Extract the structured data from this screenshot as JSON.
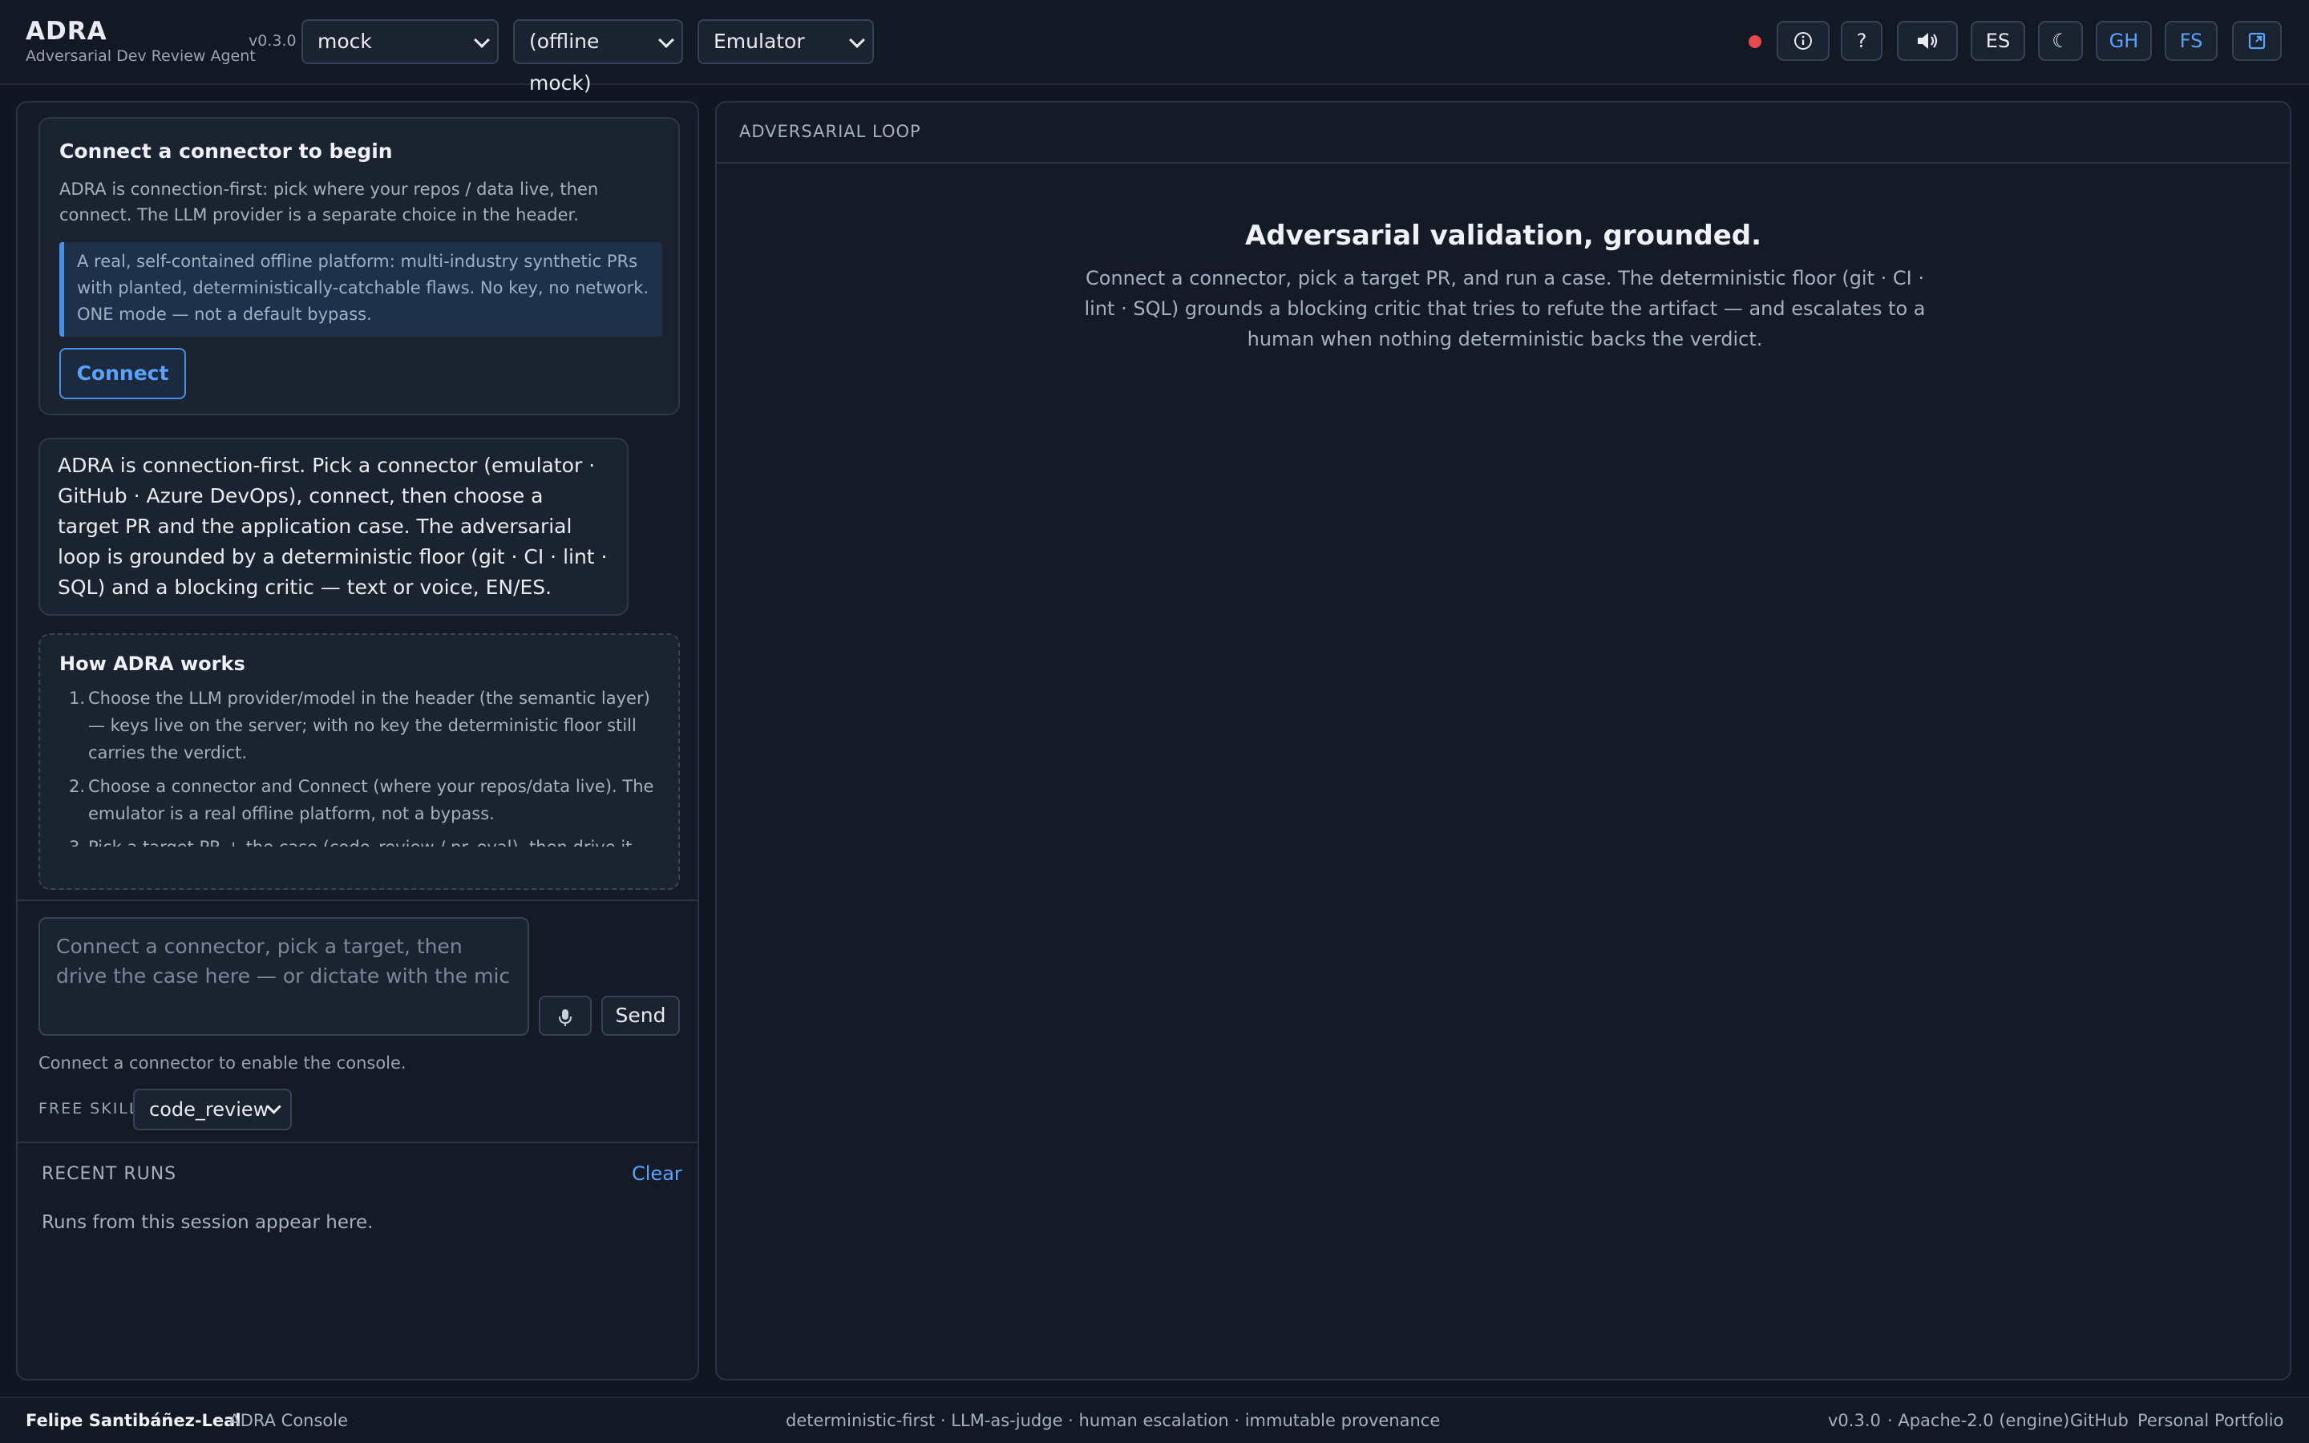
{
  "header": {
    "app_name": "ADRA",
    "app_subtitle": "Adversarial Dev Review Agent",
    "version": "v0.3.0",
    "provider_select": "mock",
    "model_select": "(offline mock)",
    "connector_select": "Emulator",
    "buttons": {
      "info": "info-icon",
      "help": "?",
      "speaker": "speaker-icon",
      "language": "ES",
      "theme": "☾",
      "github": "GH",
      "fullscreen": "FS",
      "external": "external-link-icon"
    },
    "record_indicator_color": "#e5484d"
  },
  "connector_card": {
    "title": "Connect a connector to begin",
    "text": "ADRA is connection-first: pick where your repos / data live, then connect. The LLM provider is a separate choice in the header.",
    "note": "A real, self-contained offline platform: multi-industry synthetic PRs with planted, deterministically-catchable flaws. No key, no network. ONE mode — not a default bypass.",
    "connect_label": "Connect"
  },
  "assistant_message": "ADRA is connection-first. Pick a connector (emulator · GitHub · Azure DevOps), connect, then choose a target PR and the application case. The adversarial loop is grounded by a deterministic floor (git · CI · lint · SQL) and a blocking critic — text or voice, EN/ES.",
  "how_it_works": {
    "title": "How ADRA works",
    "steps": [
      "Choose the LLM provider/model in the header (the semantic layer) — keys live on the server; with no key the deterministic floor still carries the verdict.",
      "Choose a connector and Connect (where your repos/data live). The emulator is a real offline platform, not a bypass.",
      "Pick a target PR + the case (code_review / pr_eval), then drive it"
    ]
  },
  "console": {
    "input_placeholder": "Connect a connector, pick a target, then drive the case here — or dictate with the mic",
    "mic_icon": "microphone-icon",
    "send_label": "Send",
    "hint": "Connect a connector to enable the console.",
    "skill_label": "FREE SKILL",
    "skill_value": "code_review"
  },
  "recent_runs": {
    "title": "RECENT RUNS",
    "clear_label": "Clear",
    "empty_text": "Runs from this session appear here."
  },
  "main": {
    "panel_label": "ADVERSARIAL LOOP",
    "hero_title": "Adversarial validation, grounded.",
    "hero_text": "Connect a connector, pick a target PR, and run a case. The deterministic floor (git · CI · lint · SQL) grounds a blocking critic that tries to refute the artifact — and escalates to a human when nothing deterministic backs the verdict."
  },
  "footer": {
    "author": "Felipe Santibáñez-Leal",
    "console_label": "· ADRA Console",
    "tagline": "deterministic-first · LLM-as-judge · human escalation · immutable provenance",
    "version": "v0.3.0",
    "license": "· Apache-2.0 (engine)",
    "links": [
      "GitHub",
      "Personal",
      "Portfolio"
    ]
  },
  "colors": {
    "background": "#111722",
    "panel": "#141b27",
    "accent": "#5aa2ff",
    "record": "#e5484d"
  }
}
